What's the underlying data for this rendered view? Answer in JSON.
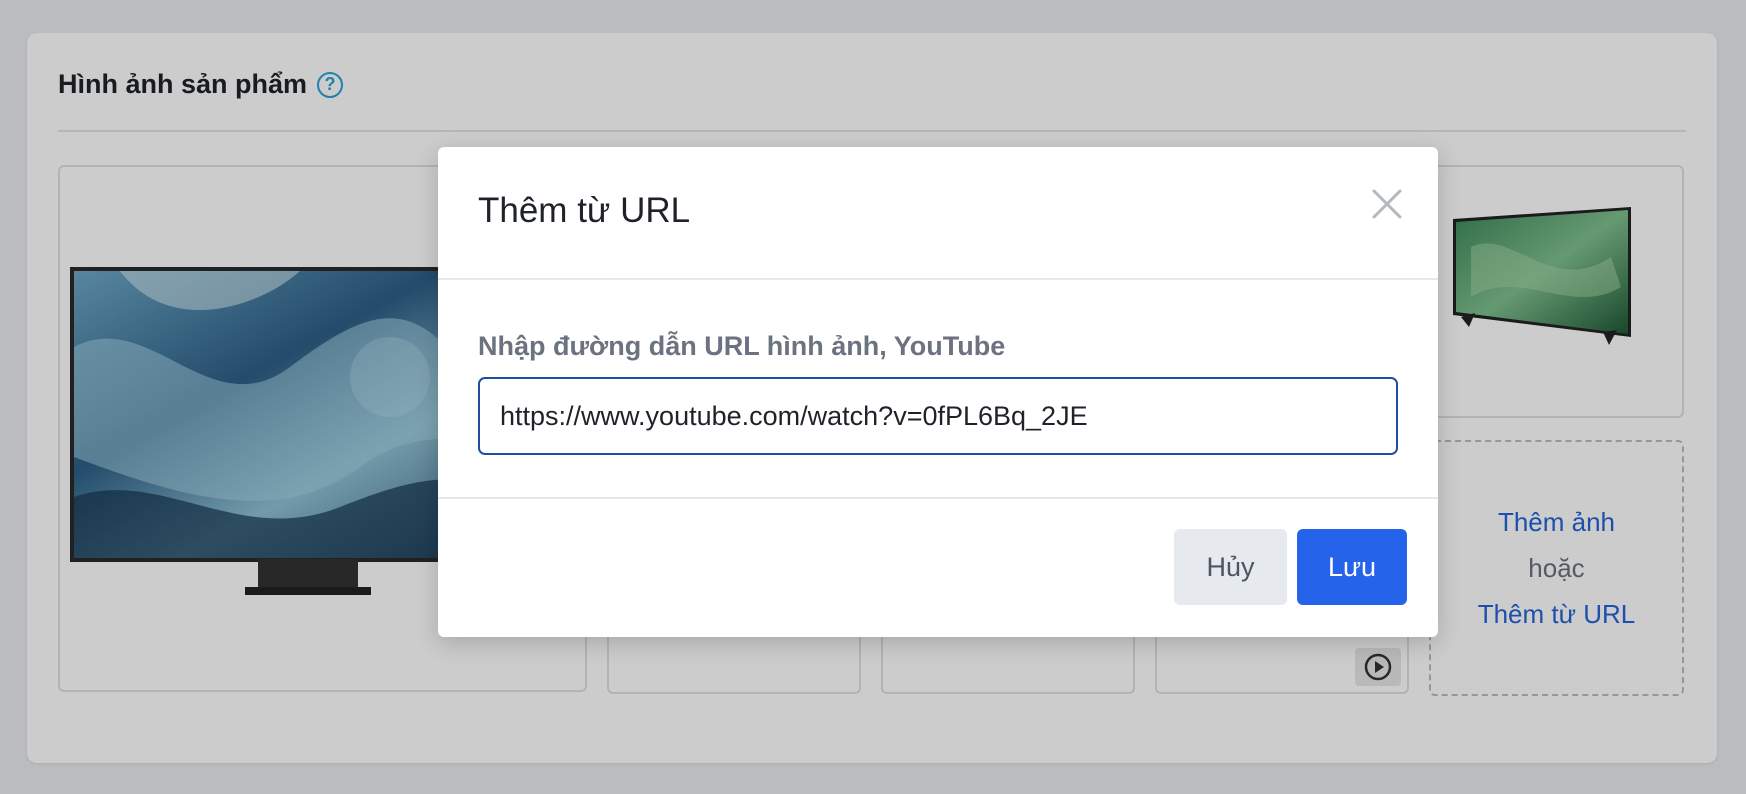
{
  "section": {
    "title": "Hình ảnh sản phẩm",
    "help_icon": "question-circle-icon"
  },
  "gallery": {
    "add_image_label": "Thêm ảnh",
    "or_label": "hoặc",
    "add_from_url_label": "Thêm từ URL",
    "video_play_icon": "play-circle-icon"
  },
  "modal": {
    "title": "Thêm từ URL",
    "field_label": "Nhập đường dẫn URL hình ảnh, YouTube",
    "url_value": "https://www.youtube.com/watch?v=0fPL6Bq_2JE",
    "cancel_label": "Hủy",
    "save_label": "Lưu",
    "close_icon": "close-icon"
  },
  "colors": {
    "accent": "#2563eb",
    "link": "#2563d8",
    "help": "#2aa1d9"
  }
}
